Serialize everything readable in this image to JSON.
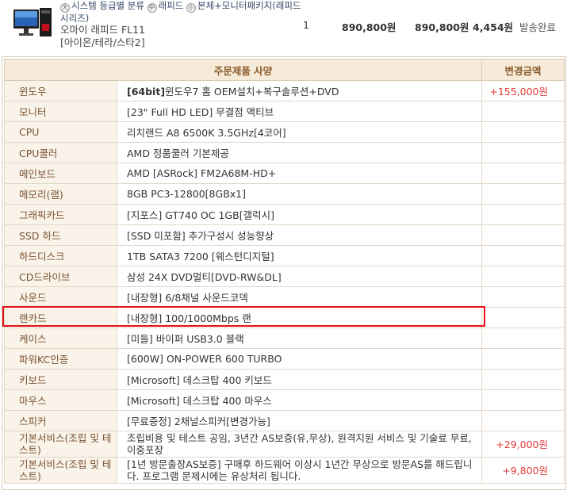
{
  "order": {
    "category_items": [
      "시스템 등급별 분류",
      "래피드",
      "본체+모니터패키지(래피드시리즈)"
    ],
    "product_name": "오마이 래피드 FL11",
    "product_sub": "[아이온/테라/스타2]",
    "quantity": "1",
    "unit_price": "890,800원",
    "total_price": "890,800원",
    "points": "4,454원",
    "status": "발송완료"
  },
  "spec_table": {
    "col_spec": "주문제품 사양",
    "col_price": "변경금액",
    "rows": [
      {
        "label": "윈도우",
        "value_bold": "[64bit]",
        "value": "윈도우7 홈 OEM설치+복구솔루션+DVD",
        "price": "+155,000원"
      },
      {
        "label": "모니터",
        "value_bold": "",
        "value": "[23\" Full HD LED] 무결점 액티브",
        "price": ""
      },
      {
        "label": "CPU",
        "value_bold": "",
        "value": "리치랜드 A8 6500K 3.5GHz[4코어]",
        "price": ""
      },
      {
        "label": "CPU쿨러",
        "value_bold": "",
        "value": "AMD 정품쿨러 기본제공",
        "price": ""
      },
      {
        "label": "메인보드",
        "value_bold": "",
        "value": "AMD [ASRock] FM2A68M-HD+",
        "price": ""
      },
      {
        "label": "메모리(램)",
        "value_bold": "",
        "value": "8GB PC3-12800[8GBx1]",
        "price": ""
      },
      {
        "label": "그래픽카드",
        "value_bold": "",
        "value": "[지포스] GT740 OC 1GB[갤럭시]",
        "price": ""
      },
      {
        "label": "SSD 하드",
        "value_bold": "",
        "value": "[SSD 미포함] 추가구성시 성능향상",
        "price": ""
      },
      {
        "label": "하드디스크",
        "value_bold": "",
        "value": "1TB SATA3 7200 [웨스턴디지털]",
        "price": ""
      },
      {
        "label": "CD드라이브",
        "value_bold": "",
        "value": "삼성 24X DVD멀티[DVD-RW&DL]",
        "price": ""
      },
      {
        "label": "사운드",
        "value_bold": "",
        "value": "[내장형] 6/8채널 사운드코덱",
        "price": ""
      },
      {
        "label": "랜카드",
        "value_bold": "",
        "value": "[내장형] 100/1000Mbps 랜",
        "price": ""
      },
      {
        "label": "케이스",
        "value_bold": "",
        "value": "[미들] 바이퍼 USB3.0 블랙",
        "price": ""
      },
      {
        "label": "파워KC인증",
        "value_bold": "",
        "value": "[600W] ON-POWER 600 TURBO",
        "price": ""
      },
      {
        "label": "키보드",
        "value_bold": "",
        "value": "[Microsoft] 데스크탑 400 키보드",
        "price": ""
      },
      {
        "label": "마우스",
        "value_bold": "",
        "value": "[Microsoft] 데스크탑 400 마우스",
        "price": ""
      },
      {
        "label": "스피커",
        "value_bold": "",
        "value": "[무료증정] 2채널스피커[변경가능]",
        "price": ""
      },
      {
        "label": "기본서비스(조립 및 테스트)",
        "value_bold": "",
        "value": "조립비용 및 테스트 공임, 3년간 AS보증(유,무상), 원격지원 서비스 및 기술료 무료, 이중포장",
        "price": "+29,000원"
      },
      {
        "label": "기본서비스(조립 및 테스트)",
        "value_bold": "",
        "value": "[1년 방문출장AS보증] 구매후 하드웨어 이상시 1년간 무상으로 방문AS를 해드립니다. 프로그램 문제시에는 유상처리 됩니다.",
        "price": "+9,800원"
      }
    ]
  }
}
